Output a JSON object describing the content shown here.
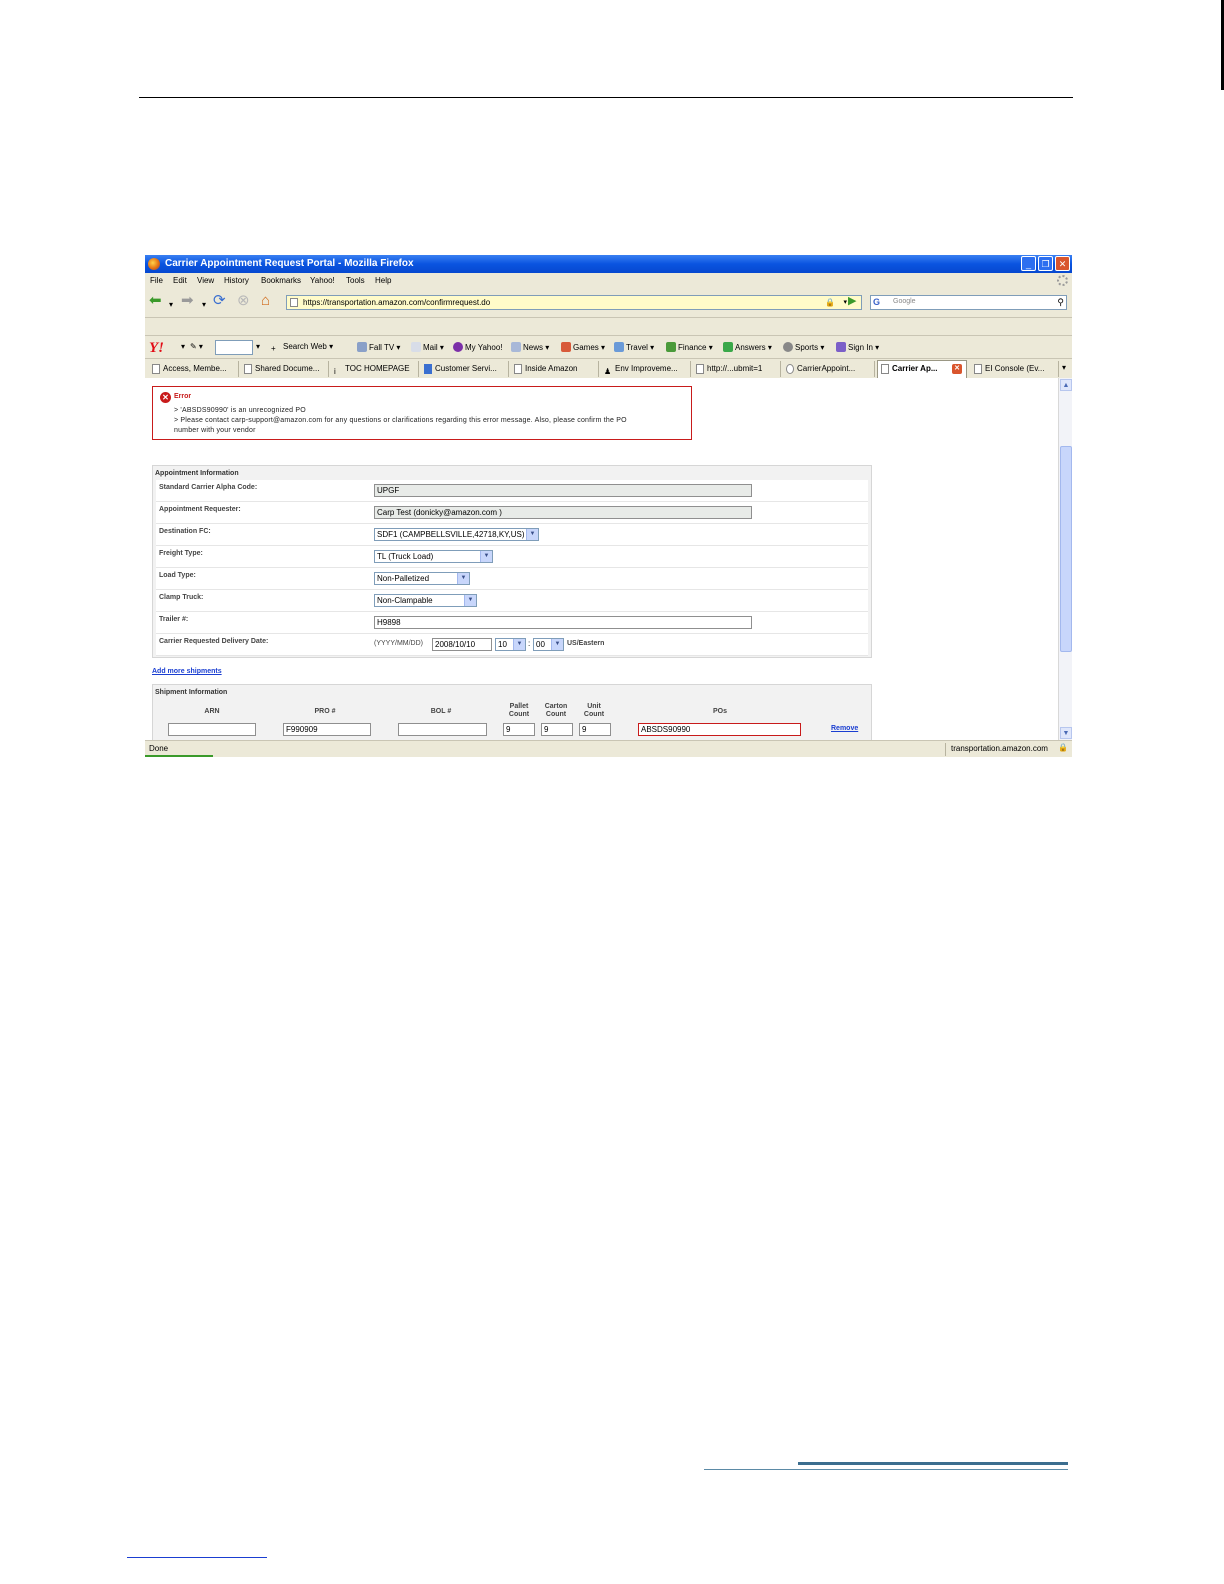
{
  "window": {
    "title": "Carrier Appointment Request Portal - Mozilla Firefox"
  },
  "menu": [
    "File",
    "Edit",
    "View",
    "History",
    "Bookmarks",
    "Yahoo!",
    "Tools",
    "Help"
  ],
  "nav": {
    "url": "https://transportation.amazon.com/confirmrequest.do",
    "search_placeholder": "Google"
  },
  "yahoo_toolbar": {
    "logo": "Y!",
    "items": [
      "Search Web",
      "Fall TV",
      "Mail",
      "My Yahoo!",
      "News",
      "Games",
      "Travel",
      "Finance",
      "Answers",
      "Sports",
      "Sign In"
    ]
  },
  "tabs": [
    "Access, Membe...",
    "Shared Docume...",
    "TOC HOMEPAGE",
    "Customer Servi...",
    "Inside Amazon",
    "Env Improveme...",
    "http://...ubmit=1",
    "CarrierAppoint...",
    "Carrier Ap...",
    "EI Console (Ev..."
  ],
  "active_tab": "Carrier Ap...",
  "error": {
    "title": "Error",
    "lines": [
      "> 'ABSDS90990' is an unrecognized PO",
      "> Please contact carp-support@amazon.com for any questions or clarifications regarding this error message. Also, please confirm the PO",
      "number with your vendor"
    ]
  },
  "appointment": {
    "heading": "Appointment Information",
    "fields": {
      "scac_label": "Standard Carrier Alpha Code:",
      "scac_value": "UPGF",
      "requester_label": "Appointment Requester:",
      "requester_value": "Carp Test (donicky@amazon.com )",
      "destination_label": "Destination FC:",
      "destination_value": "SDF1 (CAMPBELLSVILLE,42718,KY,US)",
      "freight_label": "Freight Type:",
      "freight_value": "TL (Truck Load)",
      "load_label": "Load Type:",
      "load_value": "Non-Palletized",
      "clamp_label": "Clamp Truck:",
      "clamp_value": "Non-Clampable",
      "trailer_label": "Trailer #:",
      "trailer_value": "H9898",
      "date_label": "Carrier Requested Delivery Date:",
      "date_format": "(YYYY/MM/DD)",
      "date_value": "2008/10/10",
      "hour_value": "10",
      "minute_value": "00",
      "timezone": "US/Eastern"
    }
  },
  "add_more_link": "Add more shipments",
  "shipment": {
    "heading": "Shipment Information",
    "columns": [
      "ARN",
      "PRO #",
      "BOL #",
      "Pallet Count",
      "Carton Count",
      "Unit Count",
      "POs"
    ],
    "row": {
      "arn": "",
      "pro": "F990909",
      "bol": "",
      "pallet": "9",
      "carton": "9",
      "unit": "9",
      "pos": "ABSDS90990",
      "remove": "Remove"
    }
  },
  "status": {
    "left": "Done",
    "host": "transportation.amazon.com"
  }
}
